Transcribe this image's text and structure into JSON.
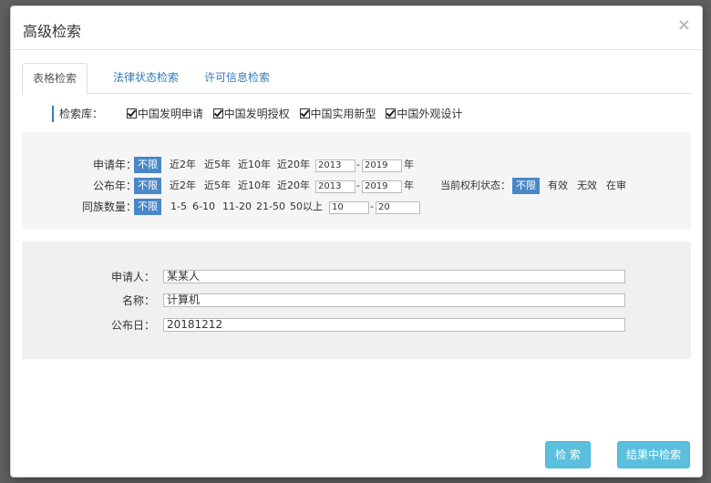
{
  "modal": {
    "title": "高级检索",
    "close": "×"
  },
  "tabs": [
    "表格检索",
    "法律状态检索",
    "许可信息检索"
  ],
  "db": {
    "label": "检索库：",
    "options": [
      "中国发明申请",
      "中国发明授权",
      "中国实用新型",
      "中国外观设计"
    ]
  },
  "filters": {
    "apply_year": {
      "label": "申请年：",
      "chip": "不限",
      "options": [
        "近2年",
        "近5年",
        "近10年",
        "近20年"
      ],
      "from": "2013",
      "dash": "-",
      "to": "2019",
      "unit": "年"
    },
    "pub_year": {
      "label": "公布年：",
      "chip": "不限",
      "options": [
        "近2年",
        "近5年",
        "近10年",
        "近20年"
      ],
      "from": "2013",
      "dash": "-",
      "to": "2019",
      "unit": "年"
    },
    "right_status": {
      "label": "当前权利状态：",
      "chip": "不限",
      "options": [
        "有效",
        "无效",
        "在审"
      ]
    },
    "family": {
      "label": "同族数量：",
      "chip": "不限",
      "options": [
        "1-5",
        "6-10",
        "11-20",
        "21-50",
        "50以上"
      ],
      "from": "10",
      "dash": "-",
      "to": "20"
    }
  },
  "fields": {
    "applicant": {
      "label": "申请人：",
      "value": "某某人"
    },
    "name": {
      "label": "名称：",
      "value": "计算机"
    },
    "pub_date": {
      "label": "公布日：",
      "value": "20181212"
    }
  },
  "buttons": {
    "search": "检 索",
    "search_in_results": "结果中检索"
  }
}
